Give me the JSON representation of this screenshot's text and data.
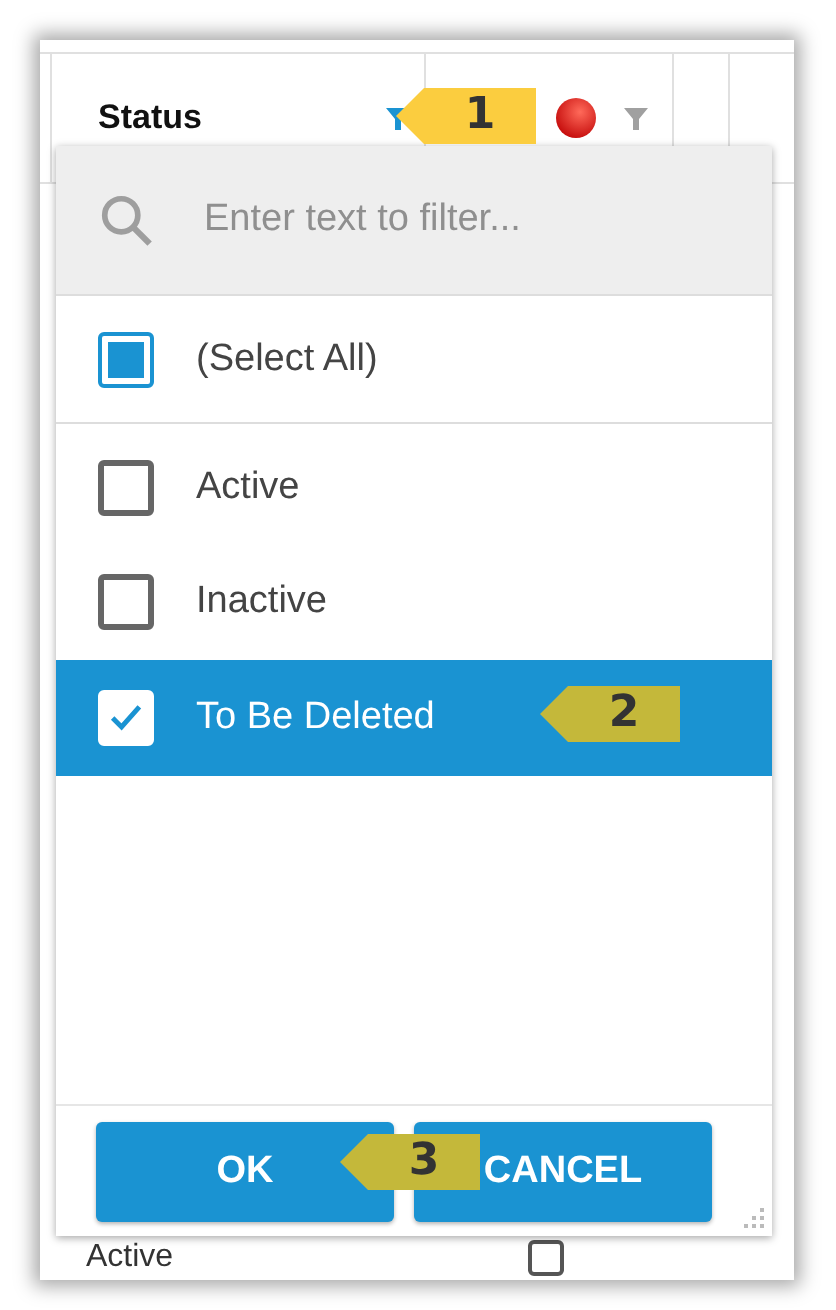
{
  "table": {
    "columns": [
      {
        "label": "Status",
        "filter_active": true
      },
      {
        "filter_active": false
      }
    ],
    "rows": [
      {
        "status": "Active",
        "checked": false
      }
    ]
  },
  "filter_popup": {
    "search": {
      "placeholder": "Enter text to filter..."
    },
    "select_all": {
      "label": "(Select All)",
      "indeterminate": true
    },
    "items": [
      {
        "label": "Active",
        "checked": false,
        "selected": false
      },
      {
        "label": "Inactive",
        "checked": false,
        "selected": false
      },
      {
        "label": "To Be Deleted",
        "checked": true,
        "selected": true
      }
    ],
    "buttons": [
      {
        "label": "OK"
      },
      {
        "label": "CANCEL"
      }
    ]
  },
  "callouts": [
    {
      "number": "1",
      "color": "#fbcd3f"
    },
    {
      "number": "2",
      "color": "#c4b83a"
    },
    {
      "number": "3",
      "color": "#c4b83a"
    }
  ]
}
